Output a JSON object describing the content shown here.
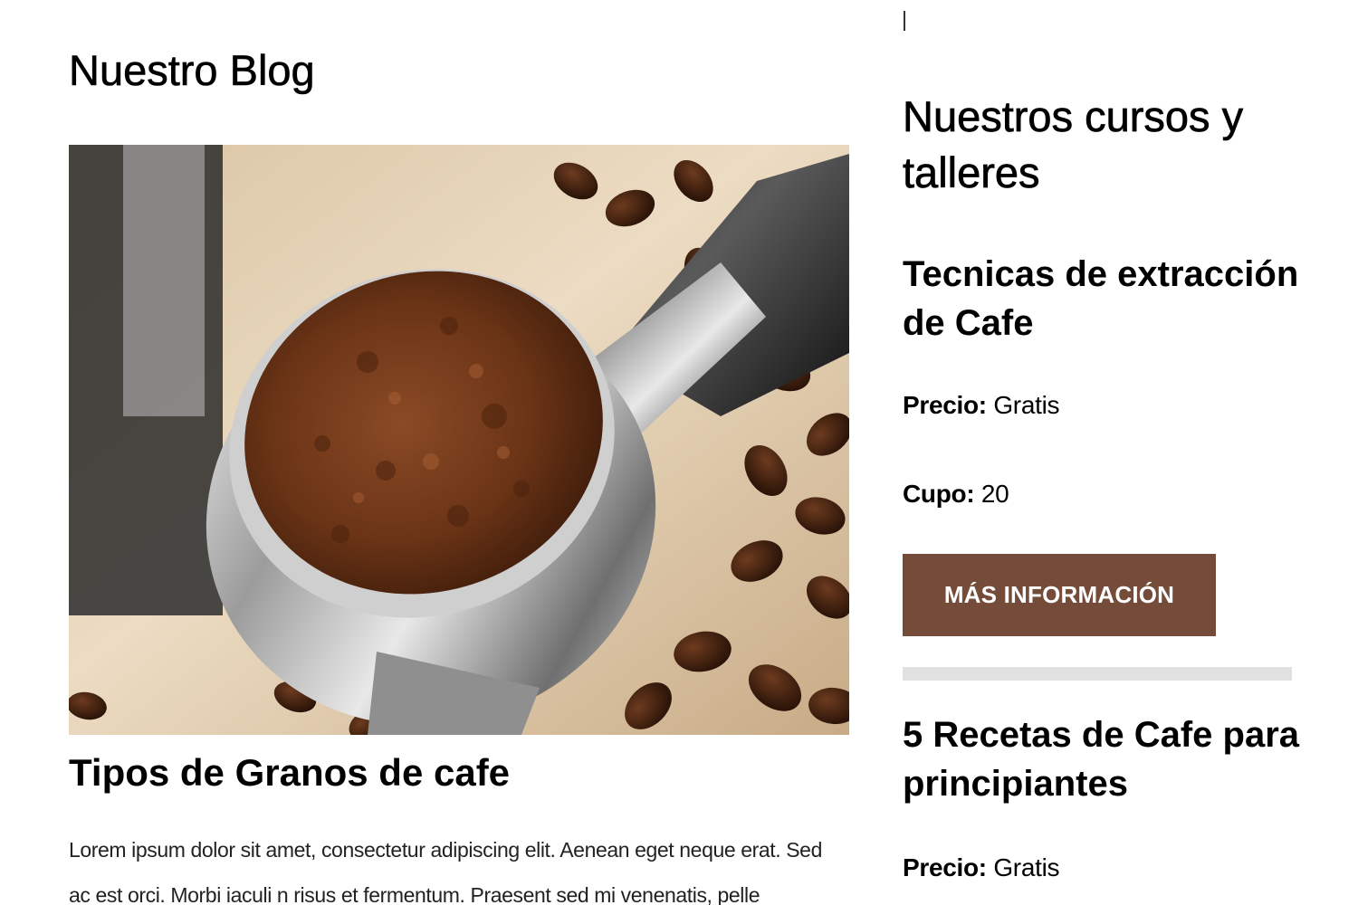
{
  "blog": {
    "heading": "Nuestro Blog",
    "post": {
      "image_alt": "Portafiltro con café molido y granos de café",
      "title": "Tipos de Granos de cafe",
      "excerpt": "Lorem ipsum dolor sit amet, consectetur adipiscing elit. Aenean eget neque erat. Sed ac est orci. Morbi iaculi n risus et fermentum. Praesent sed mi venenatis, pelle"
    }
  },
  "sidebar": {
    "heading": "Nuestros cursos y talleres",
    "courses": [
      {
        "title": "Tecnicas de extracción de Cafe",
        "price_label": "Precio:",
        "price_value": "Gratis",
        "quota_label": "Cupo:",
        "quota_value": "20",
        "button_label": "MÁS INFORMACIÓN"
      },
      {
        "title": "5 Recetas de Cafe para principiantes",
        "price_label": "Precio:",
        "price_value": "Gratis"
      }
    ]
  },
  "colors": {
    "button_bg": "#754c3a",
    "button_text": "#ffffff",
    "divider": "#e1e1e1"
  },
  "icons": {
    "cursor": "text-cursor-icon"
  }
}
